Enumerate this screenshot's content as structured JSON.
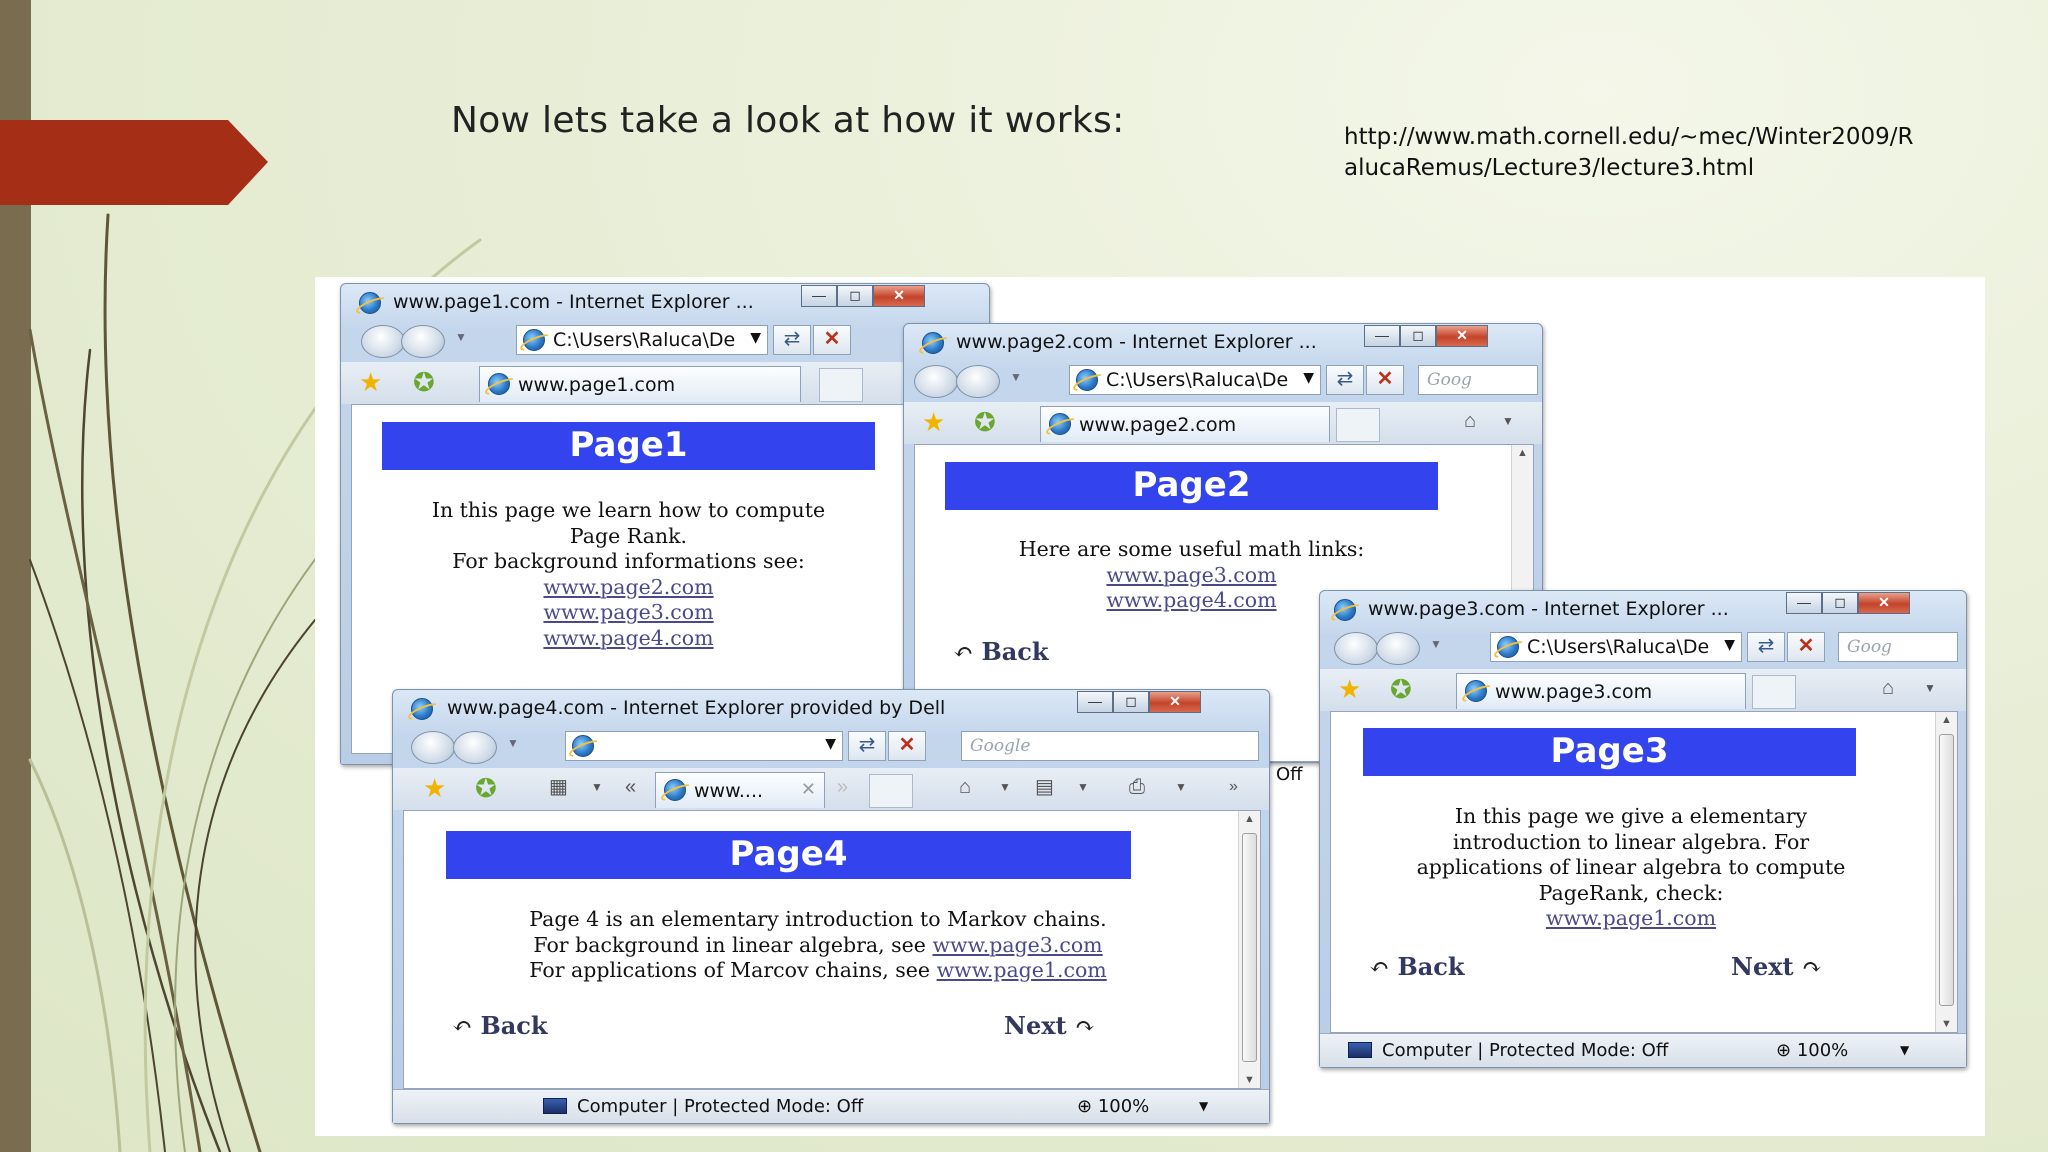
{
  "slide": {
    "title": "Now lets take a look at how it works:",
    "source_link": "http://www.math.cornell.edu/~mec/Winter2009/RalucaRemus/Lecture3/lecture3.html"
  },
  "colors": {
    "accent_arrow": "#a52f16",
    "left_bar": "#7a6c4e",
    "page_banner": "#3344ee"
  },
  "windows": {
    "page1": {
      "title": "www.page1.com - Internet Explorer ...",
      "address": "C:\\Users\\Raluca\\De",
      "tab": "www.page1.com",
      "heading": "Page1",
      "lines": [
        "In this page we learn how to compute",
        "Page Rank.",
        "For background informations see:"
      ],
      "links": [
        "www.page2.com",
        "www.page3.com",
        "www.page4.com"
      ]
    },
    "page2": {
      "title": "www.page2.com - Internet Explorer ...",
      "address": "C:\\Users\\Raluca\\De",
      "search": "Goog",
      "tab": "www.page2.com",
      "heading": "Page2",
      "intro": "Here are some useful math links:",
      "links": [
        "www.page3.com",
        "www.page4.com"
      ],
      "back": "Back",
      "status_fragment": "Off"
    },
    "page3": {
      "title": "www.page3.com - Internet Explorer ...",
      "address": "C:\\Users\\Raluca\\De",
      "search": "Goog",
      "tab": "www.page3.com",
      "heading": "Page3",
      "lines": [
        "In this page we give a elementary",
        "introduction to linear algebra. For",
        "applications of linear algebra to compute",
        "PageRank, check:"
      ],
      "link": "www.page1.com",
      "back": "Back",
      "next": "Next",
      "status": "Computer | Protected Mode: Off",
      "zoom": "100%"
    },
    "page4": {
      "title": "www.page4.com - Internet Explorer provided by Dell",
      "search": "Google",
      "tab": "www....",
      "heading": "Page4",
      "line1": "Page 4 is an elementary introduction to Markov chains.",
      "line2_prefix": "For background in linear algebra, see",
      "line2_link": "www.page3.com",
      "line3_prefix": "For applications of Marcov chains, see",
      "line3_link": "www.page1.com",
      "back": "Back",
      "next": "Next",
      "status": "Computer | Protected Mode: Off",
      "zoom": "100%"
    }
  },
  "icons": [
    "ie-logo-icon",
    "favorites-star-icon",
    "add-favorites-icon",
    "home-icon",
    "feeds-icon",
    "print-icon",
    "refresh-icon",
    "stop-icon",
    "back-arrow-icon",
    "next-arrow-icon",
    "computer-icon",
    "zoom-icon"
  ]
}
